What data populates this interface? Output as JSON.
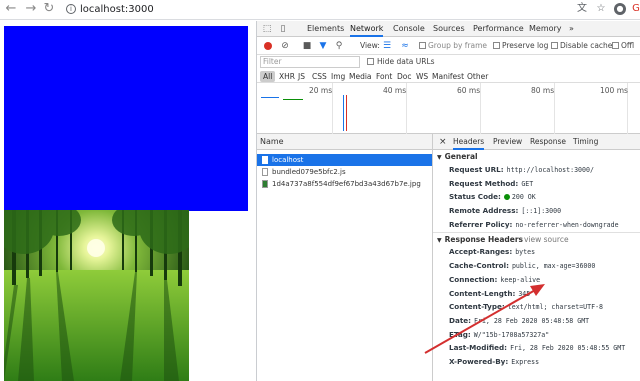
{
  "browser": {
    "url": "localhost:3000"
  },
  "devtools": {
    "tabs": [
      "Elements",
      "Network",
      "Console",
      "Sources",
      "Performance",
      "Memory",
      "»"
    ],
    "active_tab": "Network",
    "toolbar": {
      "view_label": "View:",
      "group_by_frame": "Group by frame",
      "preserve_log": "Preserve log",
      "disable_cache": "Disable cache",
      "offline": "Offl"
    },
    "filter": {
      "placeholder": "Filter",
      "hide_data_urls": "Hide data URLs"
    },
    "types": [
      "All",
      "XHR",
      "JS",
      "CSS",
      "Img",
      "Media",
      "Font",
      "Doc",
      "WS",
      "Manifest",
      "Other"
    ],
    "timeline_ticks": [
      "20 ms",
      "40 ms",
      "60 ms",
      "80 ms",
      "100 ms"
    ],
    "request_list": {
      "header": "Name",
      "rows": [
        {
          "name": "localhost",
          "selected": true
        },
        {
          "name": "bundled079e5bfc2.js",
          "selected": false
        },
        {
          "name": "1d4a737a8f554df9ef67bd3a43d67b7e.jpg",
          "selected": false
        }
      ]
    },
    "detail": {
      "close": "×",
      "tabs": [
        "Headers",
        "Preview",
        "Response",
        "Timing"
      ],
      "general": {
        "title": "General",
        "items": [
          {
            "k": "Request URL:",
            "v": "http://localhost:3000/"
          },
          {
            "k": "Request Method:",
            "v": "GET"
          },
          {
            "k": "Status Code:",
            "v": "200 OK"
          },
          {
            "k": "Remote Address:",
            "v": "[::1]:3000"
          },
          {
            "k": "Referrer Policy:",
            "v": "no-referrer-when-downgrade"
          }
        ]
      },
      "response_headers": {
        "title": "Response Headers",
        "view_source": "view source",
        "items": [
          {
            "k": "Accept-Ranges:",
            "v": "bytes"
          },
          {
            "k": "Cache-Control:",
            "v": "public, max-age=36000"
          },
          {
            "k": "Connection:",
            "v": "keep-alive"
          },
          {
            "k": "Content-Length:",
            "v": "345"
          },
          {
            "k": "Content-Type:",
            "v": "text/html; charset=UTF-8"
          },
          {
            "k": "Date:",
            "v": "Fri, 28 Feb 2020 05:48:58 GMT"
          },
          {
            "k": "ETag:",
            "v": "W/\"15b-1708a57327a\""
          },
          {
            "k": "Last-Modified:",
            "v": "Fri, 28 Feb 2020 05:48:55 GMT"
          },
          {
            "k": "X-Powered-By:",
            "v": "Express"
          }
        ]
      }
    }
  },
  "colors": {
    "blue_box": "#0000ff",
    "accent": "#1a73e8",
    "arrow": "#d32f2f"
  }
}
